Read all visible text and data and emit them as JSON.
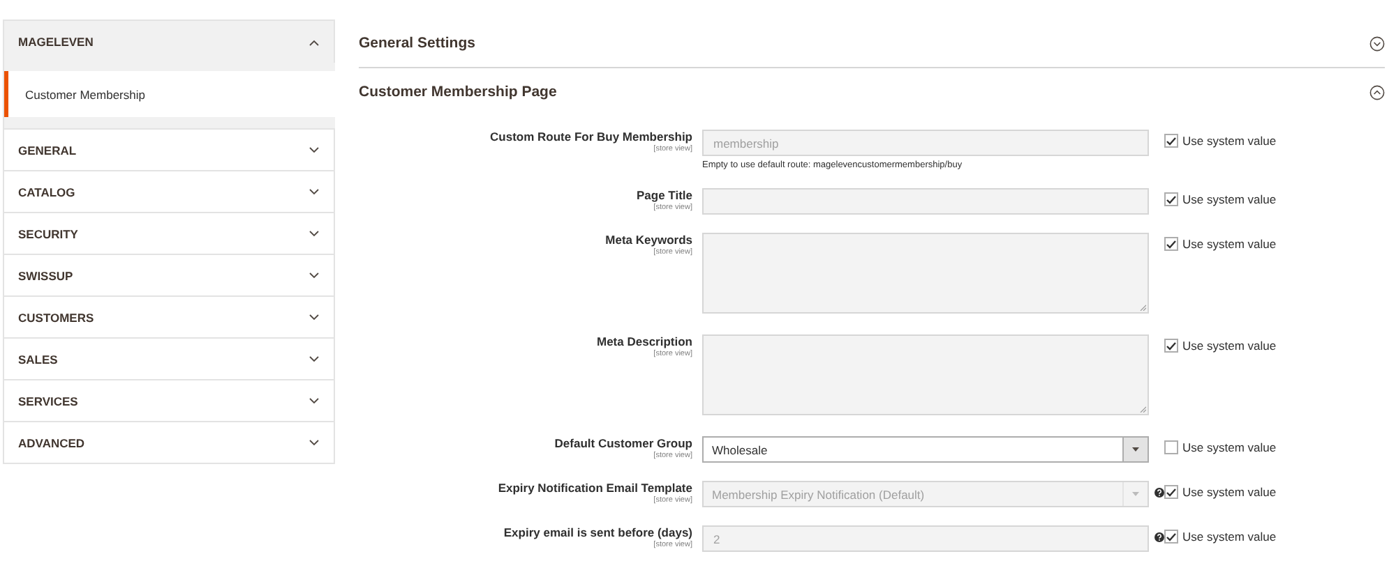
{
  "sidebar": {
    "groups": [
      {
        "label": "MAGELEVEN",
        "expanded": true,
        "children": [
          {
            "label": "Customer Membership",
            "selected": true
          }
        ]
      },
      {
        "label": "GENERAL",
        "expanded": false
      },
      {
        "label": "CATALOG",
        "expanded": false
      },
      {
        "label": "SECURITY",
        "expanded": false
      },
      {
        "label": "SWISSUP",
        "expanded": false
      },
      {
        "label": "CUSTOMERS",
        "expanded": false
      },
      {
        "label": "SALES",
        "expanded": false
      },
      {
        "label": "SERVICES",
        "expanded": false
      },
      {
        "label": "ADVANCED",
        "expanded": false
      }
    ]
  },
  "sections": [
    {
      "title": "General Settings",
      "expanded": false
    },
    {
      "title": "Customer Membership Page",
      "expanded": true,
      "fields": [
        {
          "label": "Custom Route For Buy Membership",
          "scope": "[store view]",
          "kind": "text",
          "value": "membership",
          "disabled": true,
          "help": false,
          "note": "Empty to use default route: magelevencustomermembership/buy",
          "use_system_value": {
            "label": "Use system value",
            "checked": true
          }
        },
        {
          "label": "Page Title",
          "scope": "[store view]",
          "kind": "text",
          "disabled": true,
          "help": false,
          "use_system_value": {
            "label": "Use system value",
            "checked": true
          }
        },
        {
          "label": "Meta Keywords",
          "scope": "[store view]",
          "kind": "textarea",
          "disabled": true,
          "help": false,
          "use_system_value": {
            "label": "Use system value",
            "checked": true
          }
        },
        {
          "label": "Meta Description",
          "scope": "[store view]",
          "kind": "textarea",
          "disabled": true,
          "help": false,
          "use_system_value": {
            "label": "Use system value",
            "checked": true
          }
        },
        {
          "label": "Default Customer Group",
          "scope": "[store view]",
          "kind": "select",
          "value": "Wholesale",
          "disabled": false,
          "help": false,
          "use_system_value": {
            "label": "Use system value",
            "checked": false
          }
        },
        {
          "label": "Expiry Notification Email Template",
          "scope": "[store view]",
          "kind": "select",
          "value": "Membership Expiry Notification (Default)",
          "disabled": true,
          "help": true,
          "use_system_value": {
            "label": "Use system value",
            "checked": true
          }
        },
        {
          "label": "Expiry email is sent before (days)",
          "scope": "[store view]",
          "kind": "text",
          "value": "2",
          "disabled": true,
          "help": true,
          "use_system_value": {
            "label": "Use system value",
            "checked": true
          }
        }
      ]
    }
  ]
}
